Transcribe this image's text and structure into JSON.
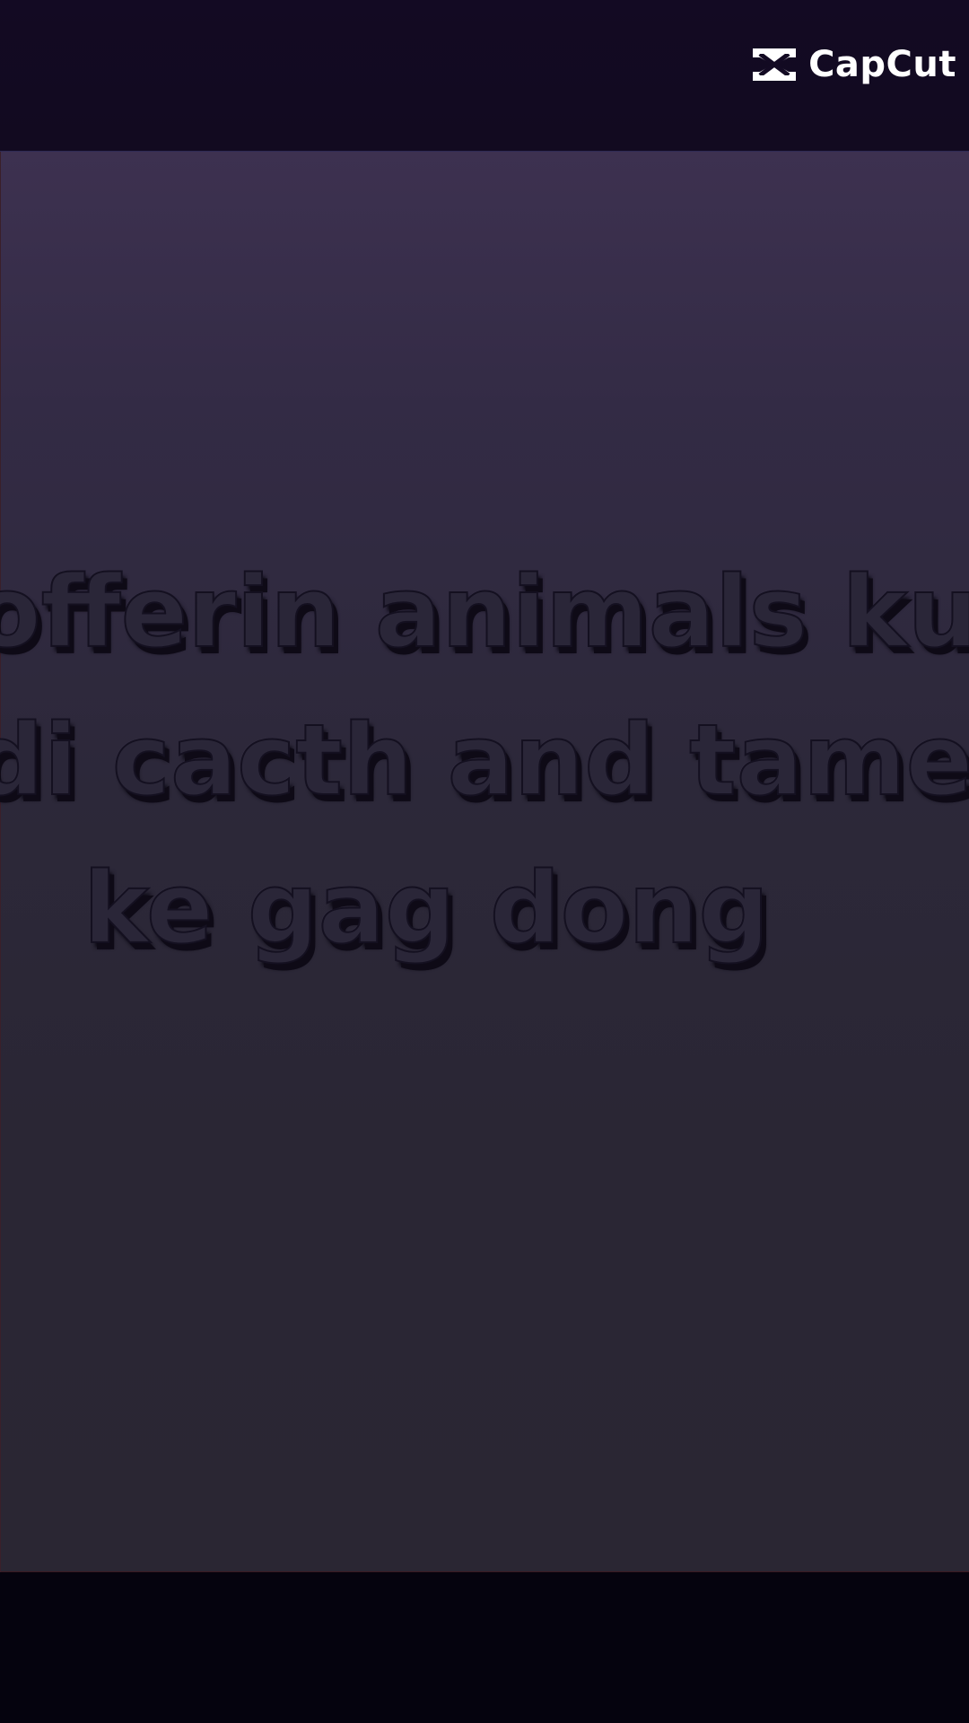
{
  "watermark": {
    "text": "CapCut",
    "icon": "capcut-logo-icon"
  },
  "caption": {
    "lines": [
      "offerin animals ku",
      "di cacth and tame",
      "ke gag dong"
    ]
  },
  "colors": {
    "top_bar": "#130a23",
    "bottom_bar": "#05030e",
    "video_top": "#3d3150",
    "video_bottom": "#2a2633",
    "caption_fill": "#2a2638",
    "watermark": "#ffffff"
  }
}
